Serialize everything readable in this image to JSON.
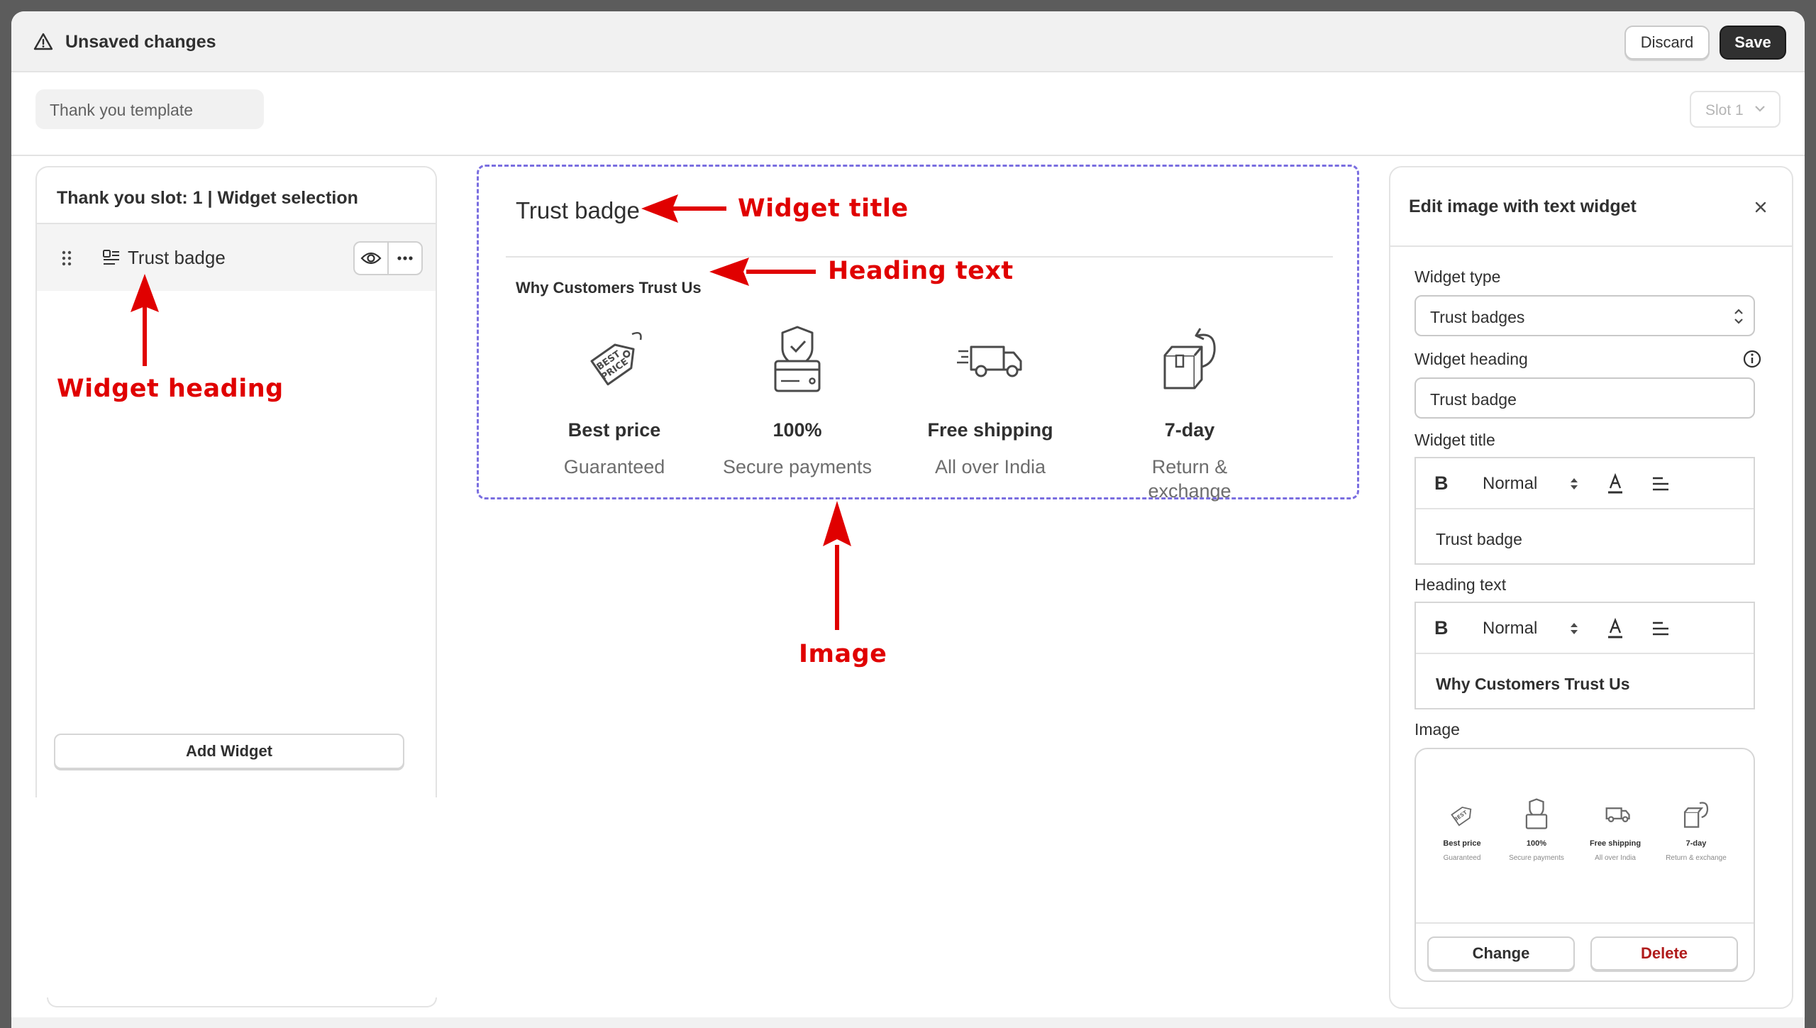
{
  "topbar": {
    "status": "Unsaved changes",
    "discard": "Discard",
    "save": "Save"
  },
  "template_select": "Thank you template",
  "slot_select": "Slot 1",
  "left_panel": {
    "title": "Thank you slot: 1 | Widget selection",
    "widget_name": "Trust badge",
    "add_widget": "Add Widget"
  },
  "preview": {
    "title": "Trust badge",
    "heading": "Why Customers Trust Us",
    "badges": [
      {
        "icon": "price-tag-icon",
        "title": "Best price",
        "subtitle": "Guaranteed"
      },
      {
        "icon": "secure-payment-icon",
        "title": "100%",
        "subtitle": "Secure payments"
      },
      {
        "icon": "delivery-truck-icon",
        "title": "Free shipping",
        "subtitle": "All over India"
      },
      {
        "icon": "return-box-icon",
        "title": "7-day",
        "subtitle": "Return & exchange"
      }
    ]
  },
  "annotations": {
    "widget_title": "Widget title",
    "heading_text": "Heading text",
    "widget_heading": "Widget heading",
    "image": "Image"
  },
  "right_panel": {
    "title": "Edit image with text widget",
    "widget_type_label": "Widget type",
    "widget_type_value": "Trust badges",
    "widget_heading_label": "Widget heading",
    "widget_heading_value": "Trust badge",
    "widget_title_label": "Widget title",
    "widget_title_format": "Normal",
    "widget_title_value": "Trust badge",
    "heading_text_label": "Heading text",
    "heading_text_format": "Normal",
    "heading_text_value": "Why Customers Trust Us",
    "image_label": "Image",
    "change": "Change",
    "delete": "Delete",
    "bold_glyph": "B"
  },
  "colors": {
    "annotation": "#e00000",
    "preview_border": "#7a6ee0",
    "save_bg": "#303030",
    "delete_text": "#b01c1c"
  }
}
